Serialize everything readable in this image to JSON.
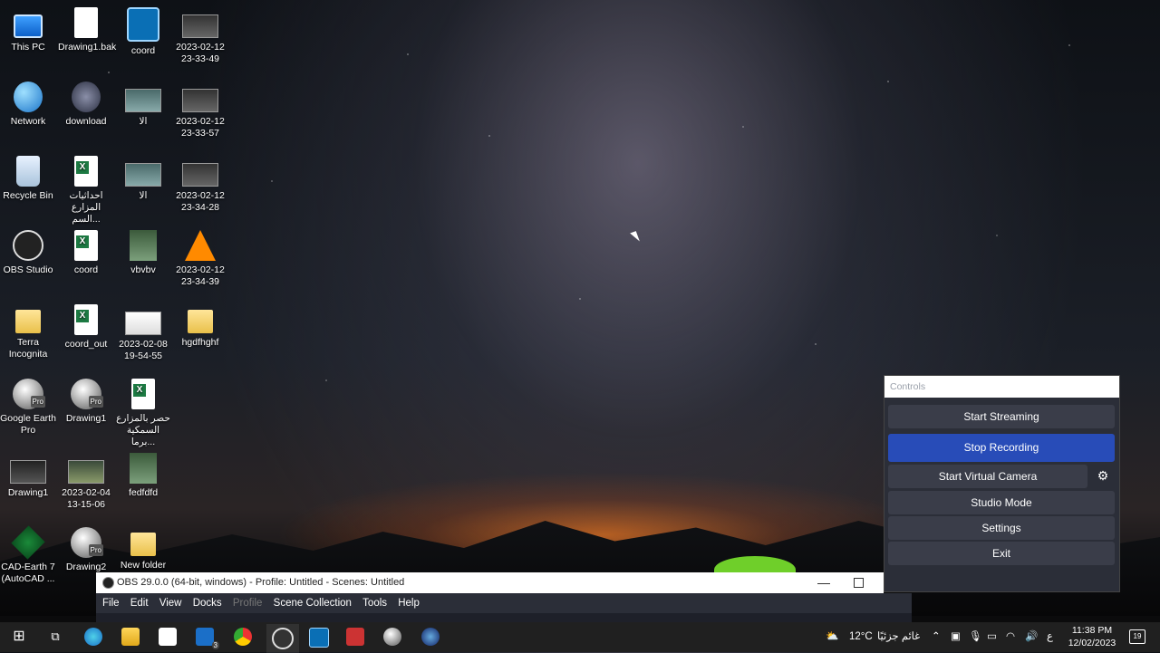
{
  "desktop": {
    "icons": [
      {
        "label": "This PC",
        "icon": "pc-icon"
      },
      {
        "label": "Drawing1.bak",
        "icon": "file-icon"
      },
      {
        "label": "coord",
        "icon": "app-icon"
      },
      {
        "label": "2023-02-12 23-33-49",
        "icon": "video-icon"
      },
      {
        "label": "Network",
        "icon": "network-icon"
      },
      {
        "label": "download",
        "icon": "image-icon"
      },
      {
        "label": "الا",
        "icon": "image-icon"
      },
      {
        "label": "2023-02-12 23-33-57",
        "icon": "video-icon"
      },
      {
        "label": "Recycle Bin",
        "icon": "recycle-bin-icon"
      },
      {
        "label": "احداثيات المزارع السم...",
        "icon": "excel-icon"
      },
      {
        "label": "الا",
        "icon": "image-icon"
      },
      {
        "label": "2023-02-12 23-34-28",
        "icon": "video-icon"
      },
      {
        "label": "OBS Studio",
        "icon": "obs-icon"
      },
      {
        "label": "coord",
        "icon": "excel-icon"
      },
      {
        "label": "vbvbv",
        "icon": "image-icon"
      },
      {
        "label": "2023-02-12 23-34-39",
        "icon": "vlc-icon"
      },
      {
        "label": "Terra Incognita",
        "icon": "folder-icon"
      },
      {
        "label": "coord_out",
        "icon": "excel-icon"
      },
      {
        "label": "2023-02-08 19-54-55",
        "icon": "video-icon"
      },
      {
        "label": "hgdfhghf",
        "icon": "folder-icon"
      },
      {
        "label": "Google Earth Pro",
        "icon": "google-earth-icon"
      },
      {
        "label": "Drawing1",
        "icon": "google-earth-icon"
      },
      {
        "label": "حصر بالمزارع السمكية برما...",
        "icon": "excel-icon"
      },
      {
        "label": "Drawing1",
        "icon": "video-icon"
      },
      {
        "label": "2023-02-04 13-15-06",
        "icon": "video-icon"
      },
      {
        "label": "fedfdfd",
        "icon": "image-icon"
      },
      {
        "label": "CAD-Earth 7 (AutoCAD ...",
        "icon": "cad-earth-icon"
      },
      {
        "label": "Drawing2",
        "icon": "google-earth-icon"
      },
      {
        "label": "New folder",
        "icon": "folder-icon"
      }
    ]
  },
  "controls": {
    "title": "Controls",
    "start_streaming": "Start Streaming",
    "stop_recording": "Stop Recording",
    "start_virtual_camera": "Start Virtual Camera",
    "studio_mode": "Studio Mode",
    "settings": "Settings",
    "exit": "Exit",
    "accent_color": "#284cb8"
  },
  "obs_window": {
    "title": "OBS 29.0.0 (64-bit, windows) - Profile: Untitled - Scenes: Untitled",
    "menu": [
      "File",
      "Edit",
      "View",
      "Docks",
      "Profile",
      "Scene Collection",
      "Tools",
      "Help"
    ]
  },
  "taskbar": {
    "weather_temp": "12°C",
    "weather_text": "غائم جزئيًا",
    "lang": "ع",
    "time": "11:38 PM",
    "date": "12/02/2023",
    "notification_count": "19",
    "mail_badge": "3"
  }
}
